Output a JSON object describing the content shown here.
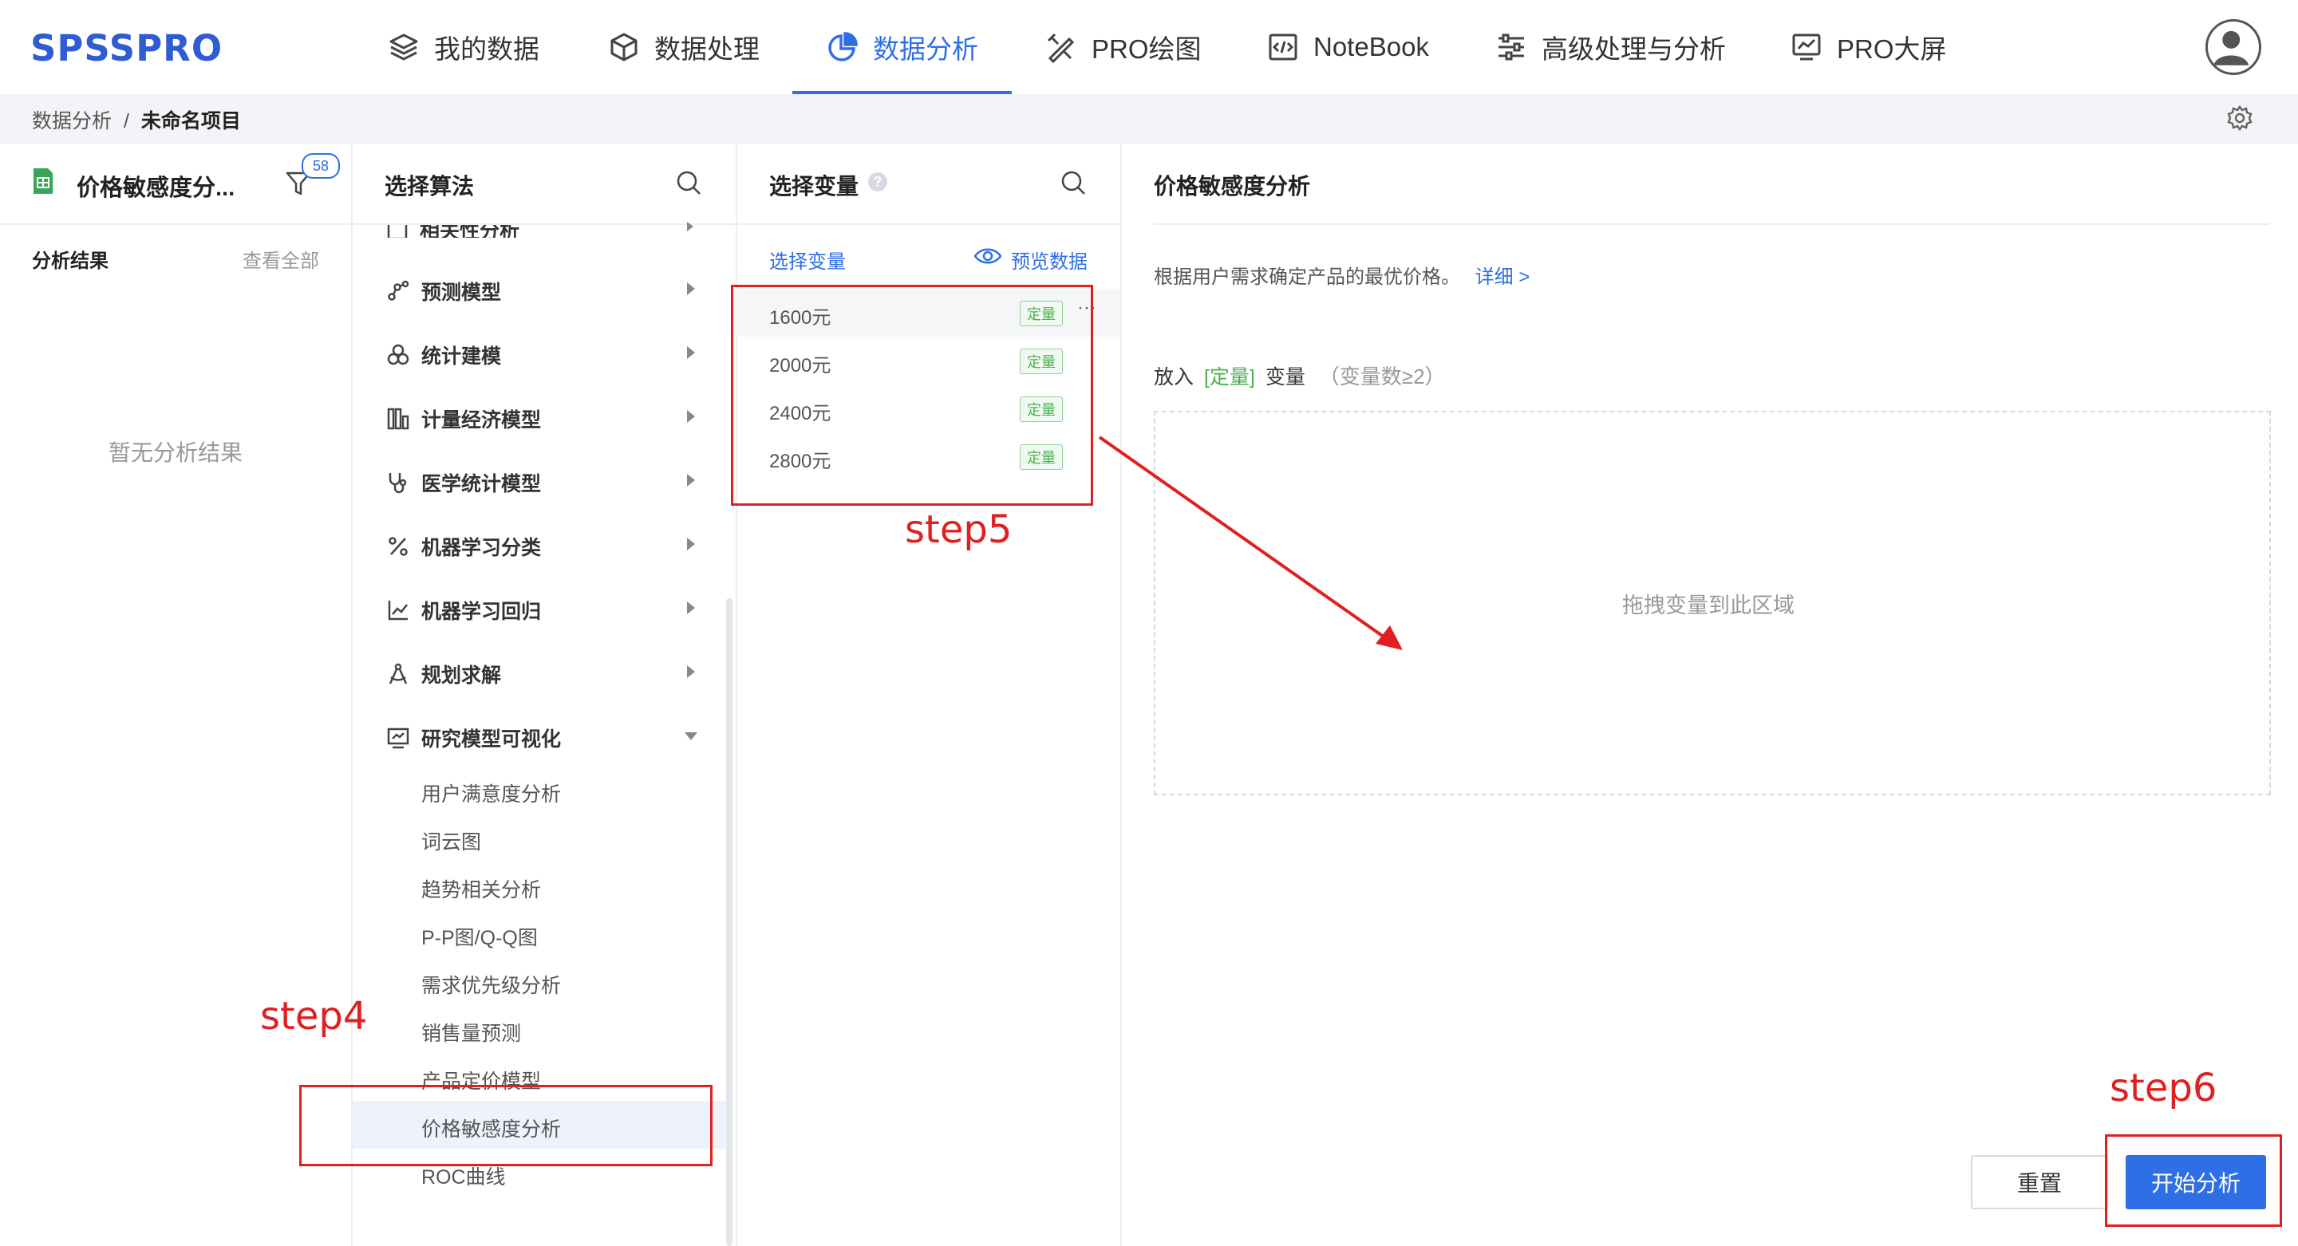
{
  "app": {
    "logo": "SPSSPRO"
  },
  "nav": [
    {
      "label": "我的数据",
      "icon": "layers-icon"
    },
    {
      "label": "数据处理",
      "icon": "cube-icon"
    },
    {
      "label": "数据分析",
      "icon": "pie-chart-icon",
      "active": true
    },
    {
      "label": "PRO绘图",
      "icon": "drawing-tools-icon"
    },
    {
      "label": "NoteBook",
      "icon": "code-icon"
    },
    {
      "label": "高级处理与分析",
      "icon": "sliders-icon"
    },
    {
      "label": "PRO大屏",
      "icon": "monitor-chart-icon"
    }
  ],
  "breadcrumb": {
    "parent": "数据分析",
    "sep": "/",
    "current": "未命名项目"
  },
  "left_panel": {
    "file_title": "价格敏感度分...",
    "filter_badge": "58",
    "results_label": "分析结果",
    "view_all": "查看全部",
    "empty_text": "暂无分析结果"
  },
  "algo_panel": {
    "title": "选择算法",
    "partial_item": "相关性分析",
    "categories": [
      {
        "label": "预测模型",
        "icon": "nodes-icon"
      },
      {
        "label": "统计建模",
        "icon": "circles-icon"
      },
      {
        "label": "计量经济模型",
        "icon": "columns-icon"
      },
      {
        "label": "医学统计模型",
        "icon": "stethoscope-icon"
      },
      {
        "label": "机器学习分类",
        "icon": "percent-icon"
      },
      {
        "label": "机器学习回归",
        "icon": "trend-chart-icon"
      },
      {
        "label": "规划求解",
        "icon": "compass-icon"
      },
      {
        "label": "研究模型可视化",
        "icon": "chart-box-icon",
        "expanded": true
      }
    ],
    "sub_items": [
      "用户满意度分析",
      "词云图",
      "趋势相关分析",
      "P-P图/Q-Q图",
      "需求优先级分析",
      "销售量预测",
      "产品定价模型",
      "价格敏感度分析",
      "ROC曲线"
    ],
    "selected_sub": "价格敏感度分析"
  },
  "var_panel": {
    "title": "选择变量",
    "subtitle": "选择变量",
    "preview": "预览数据",
    "variables": [
      {
        "name": "1600元",
        "tag": "定量"
      },
      {
        "name": "2000元",
        "tag": "定量"
      },
      {
        "name": "2400元",
        "tag": "定量"
      },
      {
        "name": "2800元",
        "tag": "定量"
      }
    ],
    "more": "···"
  },
  "config_panel": {
    "title": "价格敏感度分析",
    "description": "根据用户需求确定产品的最优价格。",
    "detail_link": "详细 >",
    "put_prefix": "放入",
    "put_type": "[定量]",
    "put_suffix": "变量",
    "put_hint": "（变量数≥2）",
    "drop_text": "拖拽变量到此区域",
    "reset_button": "重置",
    "start_button": "开始分析"
  },
  "annotations": {
    "step4": "step4",
    "step5": "step5",
    "step6": "step6"
  },
  "colors": {
    "brand": "#2f6fe5",
    "annotation": "#e02020",
    "tag": "#4caf50"
  }
}
